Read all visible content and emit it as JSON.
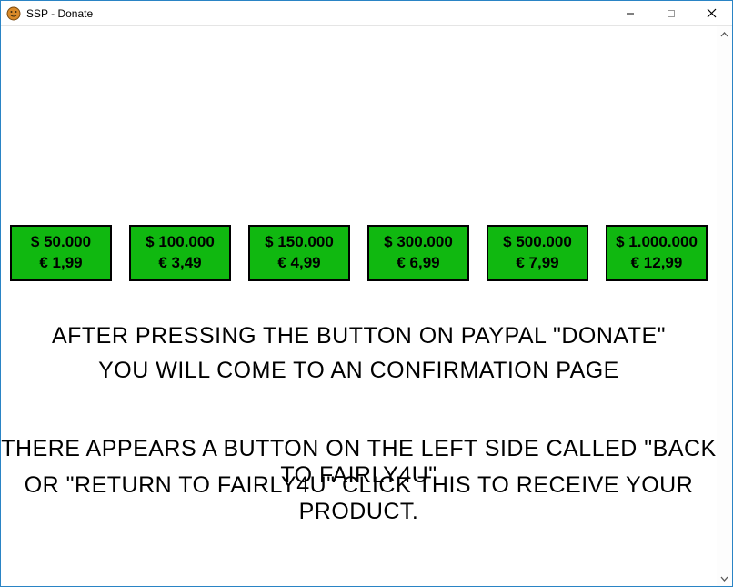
{
  "window": {
    "title": "SSP - Donate"
  },
  "tiers": [
    {
      "dollar": "$ 50.000",
      "euro": "€ 1,99"
    },
    {
      "dollar": "$ 100.000",
      "euro": "€ 3,49"
    },
    {
      "dollar": "$ 150.000",
      "euro": "€ 4,99"
    },
    {
      "dollar": "$ 300.000",
      "euro": "€ 6,99"
    },
    {
      "dollar": "$ 500.000",
      "euro": "€ 7,99"
    },
    {
      "dollar": "$ 1.000.000",
      "euro": "€ 12,99"
    }
  ],
  "messages": {
    "line1": "After pressing the button on paypal \"Donate\"",
    "line2": "you will come to an confirmation page",
    "line3": "There appears a button on the left side called \"Back to Fairly4u\"",
    "line4": "or \"Return to Fairly4u\" click this to receive your product."
  }
}
